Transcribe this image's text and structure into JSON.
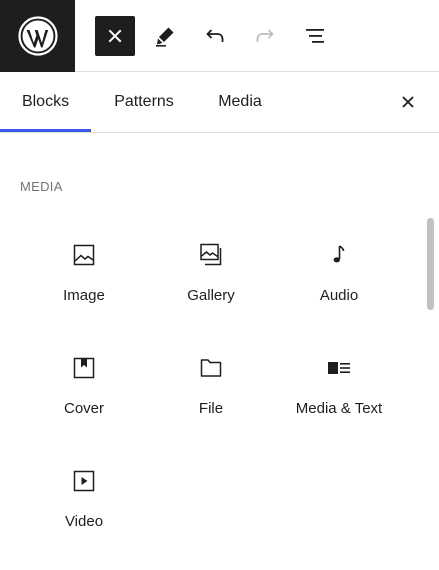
{
  "toolbar": {
    "logo_icon": "wordpress-logo",
    "close_icon": "close-icon",
    "edit_icon": "pencil-icon",
    "undo_icon": "undo-icon",
    "redo_icon": "redo-icon",
    "list_view_icon": "list-view-icon"
  },
  "tabs": [
    {
      "label": "Blocks",
      "selected": true
    },
    {
      "label": "Patterns",
      "selected": false
    },
    {
      "label": "Media",
      "selected": false
    }
  ],
  "panel": {
    "section_title": "MEDIA",
    "blocks": [
      {
        "label": "Image",
        "icon": "image-icon"
      },
      {
        "label": "Gallery",
        "icon": "gallery-icon"
      },
      {
        "label": "Audio",
        "icon": "audio-icon"
      },
      {
        "label": "Cover",
        "icon": "cover-icon"
      },
      {
        "label": "File",
        "icon": "file-icon"
      },
      {
        "label": "Media & Text",
        "icon": "media-text-icon"
      },
      {
        "label": "Video",
        "icon": "video-icon"
      }
    ]
  },
  "colors": {
    "accent": "#3858e9",
    "dark": "#1e1e1e",
    "muted_text": "#757575",
    "border": "#e0e0e0"
  }
}
